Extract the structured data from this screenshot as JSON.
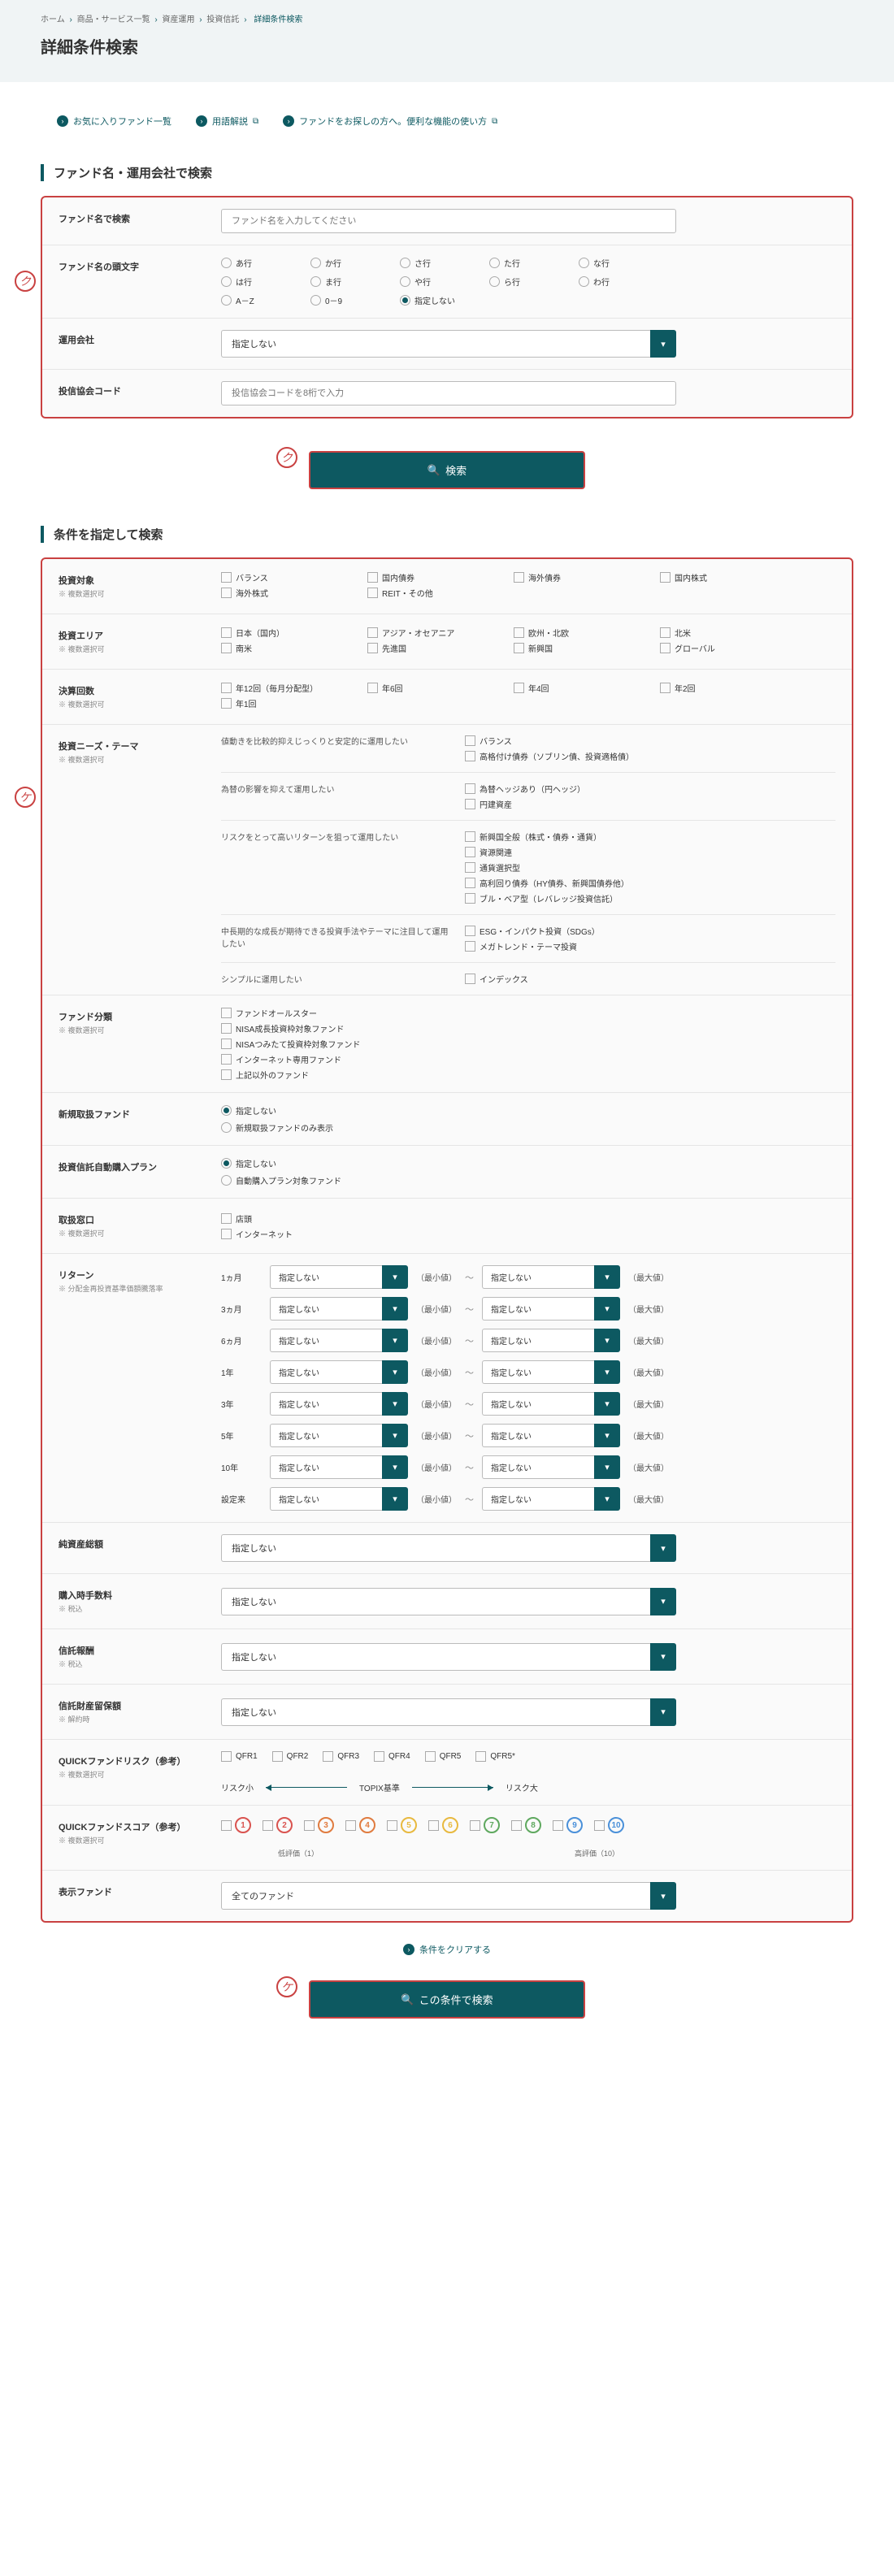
{
  "breadcrumb": [
    "ホーム",
    "商品・サービス一覧",
    "資産運用",
    "投資信託",
    "詳細条件検索"
  ],
  "pageTitle": "詳細条件検索",
  "topLinks": {
    "favorites": "お気に入りファンド一覧",
    "glossary": "用語解説",
    "guide": "ファンドをお探しの方へ。便利な機能の使い方"
  },
  "section1": {
    "title": "ファンド名・運用会社で検索",
    "marker": "ク",
    "fundName": {
      "label": "ファンド名で検索",
      "placeholder": "ファンド名を入力してください"
    },
    "initial": {
      "label": "ファンド名の頭文字",
      "options": [
        "あ行",
        "か行",
        "さ行",
        "た行",
        "な行",
        "は行",
        "ま行",
        "や行",
        "ら行",
        "わ行",
        "A－Z",
        "0－9",
        "指定しない"
      ],
      "selected": "指定しない"
    },
    "company": {
      "label": "運用会社",
      "value": "指定しない"
    },
    "code": {
      "label": "投信協会コード",
      "placeholder": "投信協会コードを8桁で入力"
    },
    "searchBtn": "検索"
  },
  "section2": {
    "title": "条件を指定して検索",
    "marker": "ケ",
    "multiNote": "※ 複数選択可",
    "target": {
      "label": "投資対象",
      "options": [
        "バランス",
        "国内債券",
        "海外債券",
        "国内株式",
        "海外株式",
        "REIT・その他"
      ]
    },
    "area": {
      "label": "投資エリア",
      "options": [
        "日本（国内）",
        "アジア・オセアニア",
        "欧州・北欧",
        "北米",
        "南米",
        "先進国",
        "新興国",
        "グローバル"
      ]
    },
    "settlement": {
      "label": "決算回数",
      "options": [
        "年12回（毎月分配型）",
        "年6回",
        "年4回",
        "年2回",
        "年1回"
      ]
    },
    "needs": {
      "label": "投資ニーズ・テーマ",
      "groups": [
        {
          "desc": "値動きを比較的抑えじっくりと安定的に運用したい",
          "items": [
            "バランス",
            "高格付け債券（ソブリン債、投資適格債）"
          ]
        },
        {
          "desc": "為替の影響を抑えて運用したい",
          "items": [
            "為替ヘッジあり（円ヘッジ）",
            "円建資産"
          ]
        },
        {
          "desc": "リスクをとって高いリターンを狙って運用したい",
          "items": [
            "新興国全般（株式・債券・通貨）",
            "資源関連",
            "通貨選択型",
            "高利回り債券（HY債券、新興国債券他）",
            "ブル・ベア型（レバレッジ投資信託）"
          ]
        },
        {
          "desc": "中長期的な成長が期待できる投資手法やテーマに注目して運用したい",
          "items": [
            "ESG・インパクト投資（SDGs）",
            "メガトレンド・テーマ投資"
          ]
        },
        {
          "desc": "シンプルに運用したい",
          "items": [
            "インデックス"
          ]
        }
      ]
    },
    "category": {
      "label": "ファンド分類",
      "options": [
        "ファンドオールスター",
        "NISA成長投資枠対象ファンド",
        "NISAつみたて投資枠対象ファンド",
        "インターネット専用ファンド",
        "上記以外のファンド"
      ]
    },
    "newFund": {
      "label": "新規取扱ファンド",
      "options": [
        "指定しない",
        "新規取扱ファンドのみ表示"
      ],
      "selected": "指定しない"
    },
    "autoPlan": {
      "label": "投資信託自動購入プラン",
      "options": [
        "指定しない",
        "自動購入プラン対象ファンド"
      ],
      "selected": "指定しない"
    },
    "counter": {
      "label": "取扱窓口",
      "options": [
        "店頭",
        "インターネット"
      ]
    },
    "returns": {
      "label": "リターン",
      "sub": "※ 分配金再投資基準価額騰落率",
      "periods": [
        "1ヵ月",
        "3ヵ月",
        "6ヵ月",
        "1年",
        "3年",
        "5年",
        "10年",
        "設定来"
      ],
      "minVal": "指定しない",
      "minLabel": "（最小値）",
      "maxVal": "指定しない",
      "maxLabel": "（最大値）"
    },
    "netAssets": {
      "label": "純資産総額",
      "value": "指定しない"
    },
    "purchaseFee": {
      "label": "購入時手数料",
      "sub": "※ 税込",
      "value": "指定しない"
    },
    "trustFee": {
      "label": "信託報酬",
      "sub": "※ 税込",
      "value": "指定しない"
    },
    "reserveFee": {
      "label": "信託財産留保額",
      "sub": "※ 解約時",
      "value": "指定しない"
    },
    "qfr": {
      "label": "QUICKファンドリスク（参考）",
      "options": [
        "QFR1",
        "QFR2",
        "QFR3",
        "QFR4",
        "QFR5",
        "QFR5*"
      ],
      "scaleLow": "リスク小",
      "scaleMid": "TOPIX基準",
      "scaleHigh": "リスク大"
    },
    "score": {
      "label": "QUICKファンドスコア（参考）",
      "values": [
        1,
        2,
        3,
        4,
        5,
        6,
        7,
        8,
        9,
        10
      ],
      "colors": [
        "#d9534f",
        "#d9534f",
        "#e07b3f",
        "#e07b3f",
        "#e8b93f",
        "#e8b93f",
        "#5fa85f",
        "#5fa85f",
        "#4a90d9",
        "#4a90d9"
      ],
      "low": "低評価（1）",
      "high": "高評価（10）"
    },
    "display": {
      "label": "表示ファンド",
      "value": "全てのファンド"
    },
    "clearLink": "条件をクリアする",
    "searchBtn": "この条件で検索"
  }
}
